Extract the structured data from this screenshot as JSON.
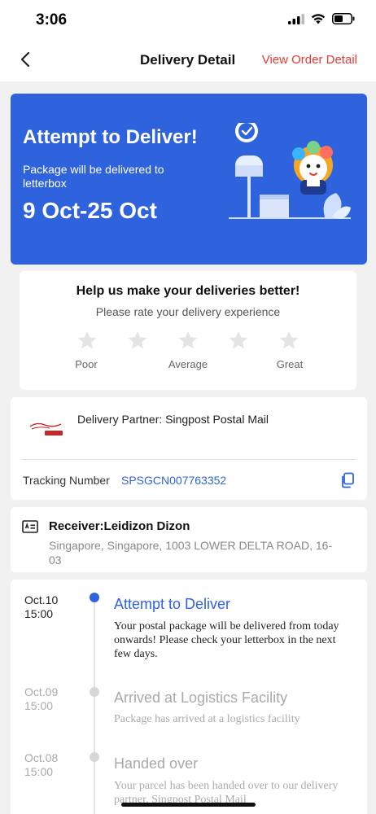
{
  "status_bar": {
    "time": "3:06"
  },
  "nav": {
    "title": "Delivery Detail",
    "order_link": "View Order Detail"
  },
  "hero": {
    "title": "Attempt to Deliver!",
    "subtitle": "Package will be delivered to letterbox",
    "date_range": "9 Oct-25 Oct",
    "background_color": "#2f63de"
  },
  "rating": {
    "title": "Help us make your deliveries better!",
    "subtitle": "Please rate your delivery experience",
    "labels": [
      "Poor",
      "Average",
      "Great"
    ],
    "stars_filled": 0,
    "stars_total": 5
  },
  "partner": {
    "label": "Delivery Partner: Singpost Postal Mail",
    "tracking_label": "Tracking Number",
    "tracking_number": "SPSGCN007763352"
  },
  "receiver": {
    "name": "Receiver:Leidizon Dizon",
    "address": "Singapore, Singapore, 1003 LOWER DELTA ROAD, 16-03"
  },
  "timeline": [
    {
      "date": "Oct.10",
      "time": "15:00",
      "title": "Attempt to Deliver",
      "description": "Your postal package will be delivered from today onwards! Please check your letterbox in the next few days.",
      "active": true
    },
    {
      "date": "Oct.09",
      "time": "15:00",
      "title": "Arrived at Logistics Facility",
      "description": "Package has arrived at a logistics facility",
      "active": false
    },
    {
      "date": "Oct.08",
      "time": "15:00",
      "title": "Handed over",
      "description": "Your parcel has been handed over to our delivery partner, Singpost Postal Mail",
      "active": false
    }
  ],
  "colors": {
    "accent": "#2f63de",
    "link_red": "#e53935"
  }
}
